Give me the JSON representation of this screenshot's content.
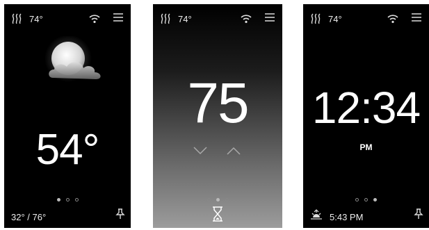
{
  "status_bar": {
    "indoor_temp": "74°"
  },
  "weather_screen": {
    "current_temp": "54°",
    "hi_lo": "32° / 76°",
    "condition_icon": "partly-cloudy-night-icon",
    "page_indicator_active": 0
  },
  "thermostat_screen": {
    "setpoint": "75",
    "page_indicator_active": 1,
    "bottom_icon": "hourglass-icon"
  },
  "clock_screen": {
    "time": "12:34",
    "ampm": "PM",
    "sunset_time": "5:43 PM",
    "page_indicator_active": 2
  },
  "colors": {
    "background": "#000000",
    "text": "#ffffff",
    "dot_inactive": "#888888",
    "dot_active": "#bbbbbb"
  }
}
